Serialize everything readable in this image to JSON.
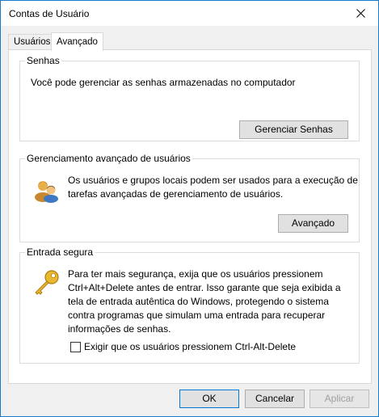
{
  "window": {
    "title": "Contas de Usuário"
  },
  "tabs": [
    {
      "label": "Usuários",
      "active": false
    },
    {
      "label": "Avançado",
      "active": true
    }
  ],
  "passwords": {
    "group_label": "Senhas",
    "description": "Você pode gerenciar as senhas armazenadas no computador",
    "button_label": "Gerenciar Senhas"
  },
  "advanced_users": {
    "group_label": "Gerenciamento avançado de usuários",
    "description_line1": "Os usuários e grupos locais podem ser usados para a execução de",
    "description_line2": "tarefas avançadas de gerenciamento de usuários.",
    "button_label": "Avançado",
    "icon": "users-icon"
  },
  "secure_logon": {
    "group_label": "Entrada segura",
    "description_lines": [
      "Para ter mais segurança, exija que os usuários pressionem",
      "Ctrl+Alt+Delete antes de entrar. Isso garante que seja exibida a",
      "tela de entrada autêntica do Windows, protegendo o sistema",
      "contra programas que simulam uma entrada para recuperar",
      "informações de senhas."
    ],
    "checkbox_label": "Exigir que os usuários pressionem Ctrl-Alt-Delete",
    "checkbox_checked": false,
    "icon": "key-icon"
  },
  "footer": {
    "ok_label": "OK",
    "cancel_label": "Cancelar",
    "apply_label": "Aplicar"
  },
  "colors": {
    "accent": "#0078d7",
    "window_border": "#1979ca"
  }
}
